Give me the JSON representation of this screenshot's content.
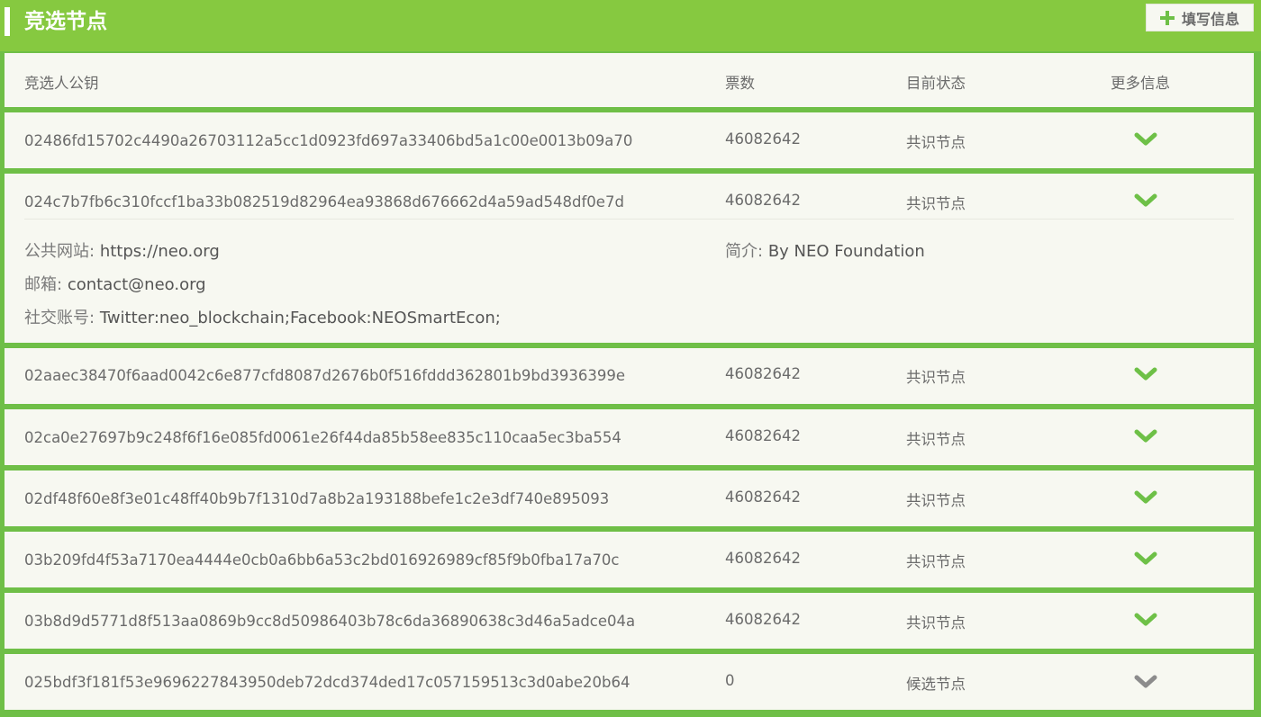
{
  "header": {
    "title": "竞选节点",
    "fill_button_label": "填写信息"
  },
  "table": {
    "columns": {
      "key": "竞选人公钥",
      "votes": "票数",
      "status": "目前状态",
      "more": "更多信息"
    },
    "rows": [
      {
        "key": "02486fd15702c4490a26703112a5cc1d0923fd697a33406bd5a1c00e0013b09a70",
        "votes": "46082642",
        "status": "共识节点",
        "expanded": false
      },
      {
        "key": "024c7b7fb6c310fccf1ba33b082519d82964ea93868d676662d4a59ad548df0e7d",
        "votes": "46082642",
        "status": "共识节点",
        "expanded": true
      },
      {
        "key": "02aaec38470f6aad0042c6e877cfd8087d2676b0f516fddd362801b9bd3936399e",
        "votes": "46082642",
        "status": "共识节点",
        "expanded": false
      },
      {
        "key": "02ca0e27697b9c248f6f16e085fd0061e26f44da85b58ee835c110caa5ec3ba554",
        "votes": "46082642",
        "status": "共识节点",
        "expanded": false
      },
      {
        "key": "02df48f60e8f3e01c48ff40b9b7f1310d7a8b2a193188befe1c2e3df740e895093",
        "votes": "46082642",
        "status": "共识节点",
        "expanded": false
      },
      {
        "key": "03b209fd4f53a7170ea4444e0cb0a6bb6a53c2bd016926989cf85f9b0fba17a70c",
        "votes": "46082642",
        "status": "共识节点",
        "expanded": false
      },
      {
        "key": "03b8d9d5771d8f513aa0869b9cc8d50986403b78c6da36890638c3d46a5adce04a",
        "votes": "46082642",
        "status": "共识节点",
        "expanded": false
      },
      {
        "key": "025bdf3f181f53e9696227843950deb72dcd374ded17c057159513c3d0abe20b64",
        "votes": "0",
        "status": "候选节点",
        "expanded": false
      }
    ]
  },
  "details": {
    "website_label": "公共网站:",
    "website_value": "https://neo.org",
    "email_label": "邮箱:",
    "email_value": "contact@neo.org",
    "social_label": "社交账号:",
    "social_value": "Twitter:neo_blockchain;Facebook:NEOSmartEcon;",
    "intro_label": "简介:",
    "intro_value": "By NEO Foundation"
  },
  "colors": {
    "header_green": "#86c940",
    "chevron_consensus": "#6ec047",
    "chevron_candidate": "#8c8c8c",
    "panel_bg": "#f7f8f1"
  },
  "icons": {
    "plus": "plus-icon",
    "expand": "chevron-down-icon"
  }
}
